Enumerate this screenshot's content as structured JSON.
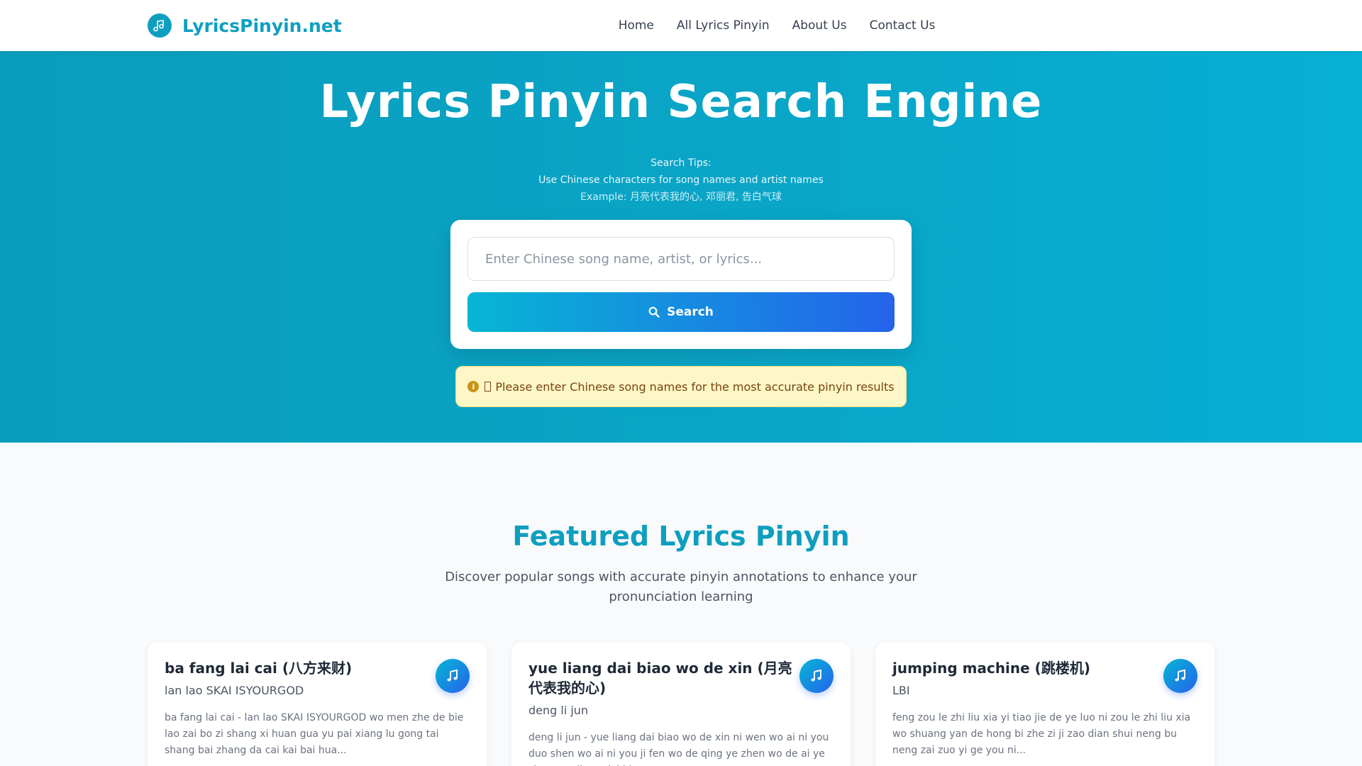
{
  "header": {
    "logo_text": "LyricsPinyin.net",
    "nav": [
      "Home",
      "All Lyrics Pinyin",
      "About Us",
      "Contact Us"
    ]
  },
  "hero": {
    "title": "Lyrics Pinyin Search Engine",
    "tips_heading": "Search Tips:",
    "tips_line": "Use Chinese characters for song names and artist names",
    "tips_example": "Example: 月亮代表我的心, 邓丽君, 告白气球",
    "search_placeholder": "Enter Chinese song name, artist, or lyrics...",
    "search_button": "Search",
    "notice": "Please enter Chinese song names for the most accurate pinyin results"
  },
  "featured": {
    "title": "Featured Lyrics Pinyin",
    "subtitle": "Discover popular songs with accurate pinyin annotations to enhance your pronunciation learning",
    "cards": [
      {
        "title": "ba fang lai cai (八方来财)",
        "artist": "lan lao SKAI ISYOURGOD",
        "excerpt": "ba fang lai cai - lan lao SKAI ISYOURGOD wo men zhe de bie lao zai bo zi shang xi huan gua yu pai xiang lu gong tai shang bai zhang da cai kai bai hua..."
      },
      {
        "title": "yue liang dai biao wo de xin (月亮代表我的心)",
        "artist": "deng li jun",
        "excerpt": "deng li jun - yue liang dai biao wo de xin ni wen wo ai ni you duo shen wo ai ni you ji fen wo de qing ye zhen wo de ai ye zhen yue liang dai biao wo..."
      },
      {
        "title": "jumping machine (跳楼机)",
        "artist": "LBI",
        "excerpt": "feng zou le zhi liu xia yi tiao jie de ye luo ni zou le zhi liu xia wo shuang yan de hong bi zhe zi ji zao dian shui neng bu neng zai zuo yi ge you ni..."
      }
    ]
  },
  "colors": {
    "brand": "#0e9fbf",
    "hero_bg": "#0aa5c7",
    "button_gradient_start": "#06b6d4",
    "button_gradient_end": "#2563eb",
    "notice_bg": "#fdf6c7"
  },
  "icons": [
    "music-note-logo-icon",
    "search-icon",
    "info-icon",
    "music-note-icon"
  ]
}
